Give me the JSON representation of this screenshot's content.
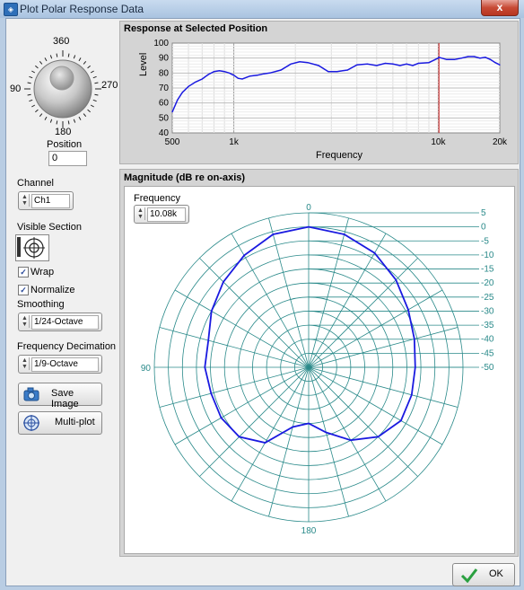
{
  "window": {
    "title": "Plot Polar Response Data",
    "close_label": "x"
  },
  "position_knob": {
    "label": "Position",
    "value": "0",
    "ticks": {
      "top": "360",
      "left": "90",
      "right": "270",
      "bottom": "180"
    }
  },
  "channel": {
    "label": "Channel",
    "value": "Ch1"
  },
  "visible_section": {
    "label": "Visible Section"
  },
  "wrap": {
    "label": "Wrap",
    "checked": true
  },
  "normalize": {
    "label": "Normalize",
    "checked": true
  },
  "smoothing": {
    "label": "Smoothing",
    "value": "1/24-Octave"
  },
  "freq_decimation": {
    "label": "Frequency Decimation",
    "value": "1/9-Octave"
  },
  "buttons": {
    "save_image": "Save Image",
    "multi_plot": "Multi-plot",
    "ok": "OK"
  },
  "response_plot": {
    "title": "Response at Selected Position",
    "ylabel": "Level",
    "xlabel": "Frequency"
  },
  "polar_plot": {
    "title": "Magnitude (dB re on-axis)",
    "frequency_label": "Frequency",
    "frequency_value": "10.08k"
  },
  "colors": {
    "trace": "#1a1ae0",
    "cursor": "#d02020",
    "polar_grid": "#2a8a8a"
  },
  "chart_data": [
    {
      "type": "line",
      "title": "Response at Selected Position",
      "xlabel": "Frequency",
      "ylabel": "Level",
      "xscale": "log",
      "xlim": [
        500,
        20000
      ],
      "ylim": [
        40,
        100
      ],
      "x_tick_labels": [
        "500",
        "1k",
        "10k",
        "20k"
      ],
      "y_tick_labels": [
        "40",
        "50",
        "60",
        "70",
        "80",
        "90",
        "100"
      ],
      "cursor_x": 10080,
      "grid": true,
      "x": [
        500,
        530,
        560,
        600,
        650,
        700,
        750,
        800,
        850,
        900,
        950,
        1000,
        1050,
        1100,
        1200,
        1300,
        1400,
        1500,
        1700,
        1900,
        2100,
        2300,
        2600,
        2900,
        3200,
        3600,
        4000,
        4500,
        5000,
        5500,
        6000,
        6500,
        7000,
        7500,
        8000,
        9000,
        10000,
        10080,
        11000,
        12000,
        13000,
        14000,
        15000,
        16000,
        17000,
        18000,
        19000,
        20000
      ],
      "y": [
        54,
        62,
        67,
        71,
        74,
        76,
        79,
        81,
        81.5,
        81,
        80,
        78.5,
        76.5,
        76,
        78,
        78.5,
        79.5,
        80,
        82,
        86,
        87.5,
        87,
        85,
        81,
        81,
        82,
        85.5,
        86,
        85,
        86.5,
        86,
        85,
        86,
        85,
        86.5,
        87,
        90,
        90.5,
        89,
        89,
        90,
        91,
        91,
        90,
        90.5,
        89,
        87,
        85.5
      ]
    },
    {
      "type": "polar",
      "title": "Magnitude (dB re on-axis)",
      "frequency": "10.08k",
      "angle_labels": [
        "0",
        "90",
        "180"
      ],
      "radial_labels": [
        "5",
        "0",
        "-5",
        "-10",
        "-15",
        "-20",
        "-25",
        "-30",
        "-35",
        "-40",
        "-45",
        "-50"
      ],
      "rlim": [
        -50,
        5
      ],
      "angles_deg": [
        0,
        15,
        30,
        45,
        60,
        75,
        90,
        105,
        120,
        135,
        150,
        165,
        180,
        195,
        210,
        225,
        240,
        255,
        270,
        285,
        300,
        315,
        330,
        345
      ],
      "values_db": [
        0,
        -1,
        -4,
        -7,
        -10,
        -13,
        -13,
        -14,
        -14,
        -15,
        -19,
        -28,
        -30,
        -26,
        -20,
        -15,
        -12,
        -12,
        -12,
        -11,
        -9,
        -6,
        -3,
        -1
      ]
    }
  ]
}
